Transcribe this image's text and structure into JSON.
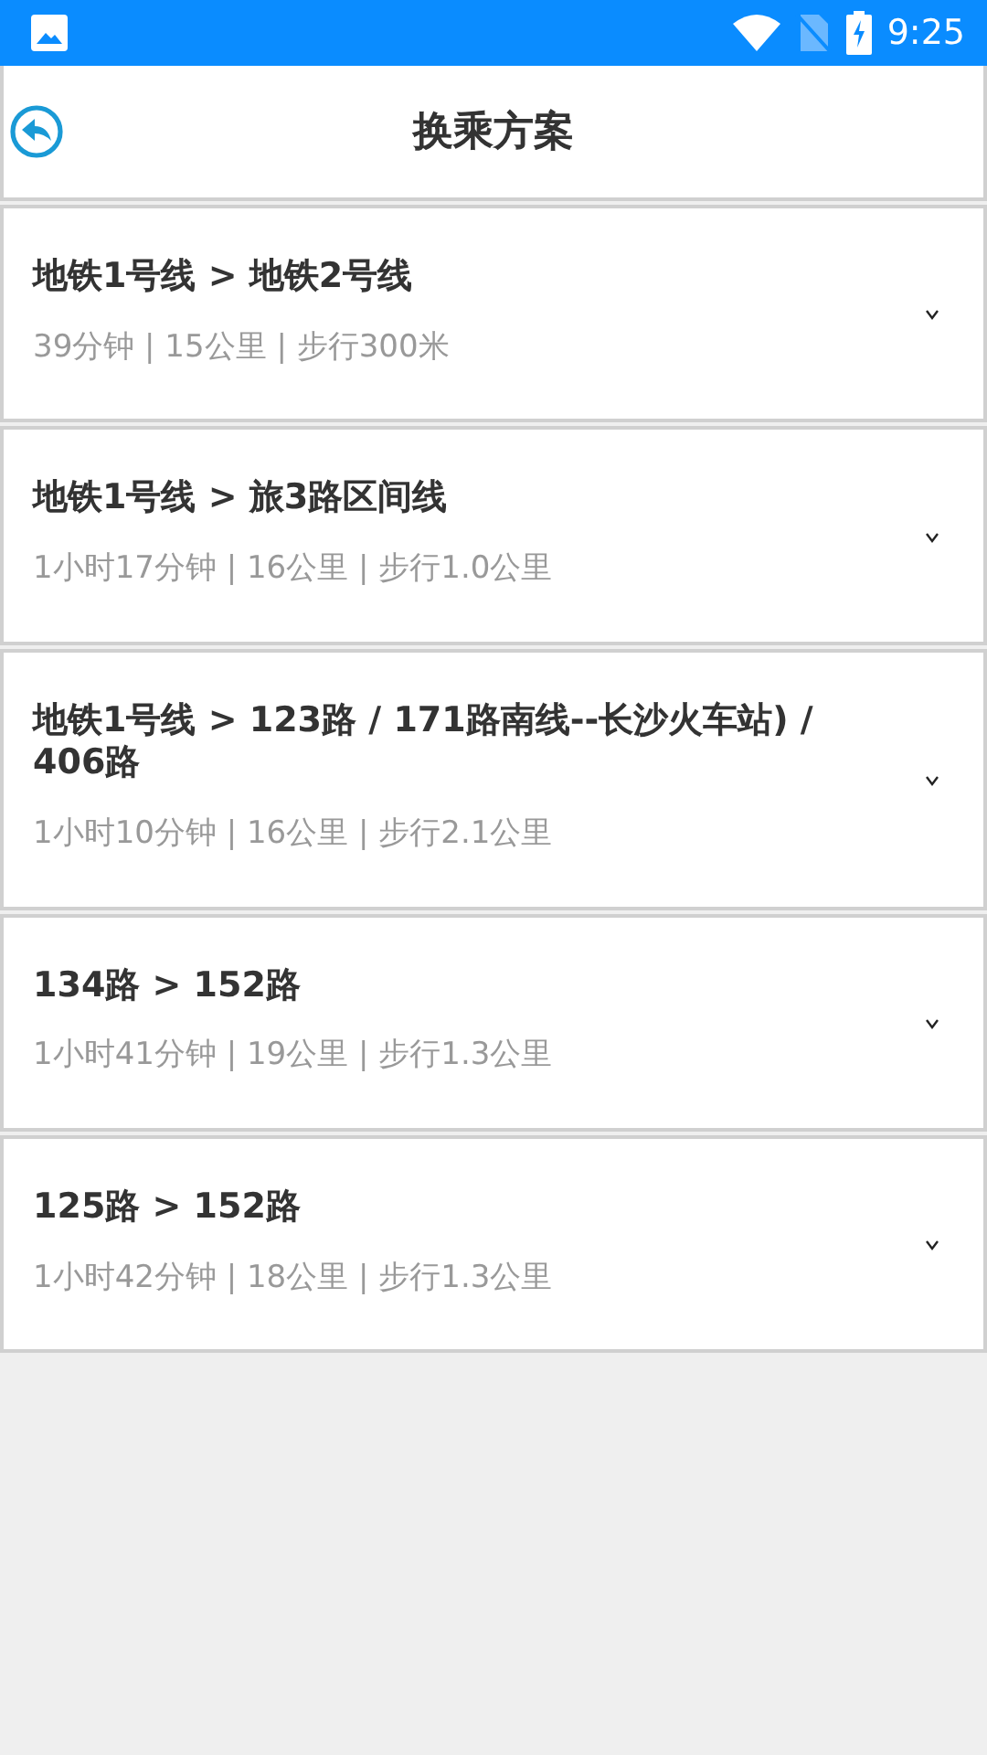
{
  "status_bar": {
    "time": "9:25"
  },
  "header": {
    "title": "换乘方案"
  },
  "plans": [
    {
      "route": "地铁1号线 > 地铁2号线",
      "summary": "39分钟 | 15公里 | 步行300米",
      "expanded": false
    },
    {
      "route": "地铁1号线 > 旅3路区间线",
      "summary": "1小时17分钟 | 16公里 | 步行1.0公里",
      "expanded": false
    },
    {
      "route": "地铁1号线 > 123路 / 171路南线--长沙火车站) / 406路",
      "summary": "1小时10分钟 | 16公里 | 步行2.1公里",
      "expanded": false
    },
    {
      "route": "134路 > 152路",
      "summary": "1小时41分钟 | 19公里 | 步行1.3公里",
      "expanded": false
    },
    {
      "route": "125路 > 152路",
      "summary": "1小时42分钟 | 18公里 | 步行1.3公里",
      "expanded": false
    }
  ]
}
